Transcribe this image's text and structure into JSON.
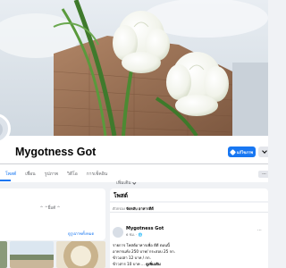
{
  "profile": {
    "name": "Mygotness Got"
  },
  "header": {
    "edit_label": "แก้ไขภาพ",
    "more_label": "⌄"
  },
  "tabs": [
    {
      "label": "โพสต์"
    },
    {
      "label": "เพื่อน"
    },
    {
      "label": "รูปภาพ"
    },
    {
      "label": "วิดีโอ"
    },
    {
      "label": "การเช็คอิน"
    },
    {
      "label": "เพิ่มเติม"
    }
  ],
  "tabs_more_right": "···",
  "intro": {
    "text": "^ ^ยิ้มดี ^",
    "link": "ดูรูปภาพทั้งหมด"
  },
  "posts": {
    "title": "โพสต์",
    "filter_prefix": "ตัวกรอง",
    "filter_value": "จัดหลับ อาหารดีดี",
    "author": "Mygotness Got",
    "meta": "6 ชม. · 🌐",
    "lines": [
      "รายการ โพสต์อาหารเพื่อ ดีดี ตอนนี้",
      "อาหารแห้ง 250 บาท/ กระสอบ 25 กก.",
      "ข้าวเปล่า 12 บาท / กก.",
      "ข้าวสาร 10 บาท ... "
    ],
    "see_more": "ดูเพิ่มเติม"
  },
  "colors": {
    "accent": "#1877f2",
    "background": "#f0f2f5"
  }
}
